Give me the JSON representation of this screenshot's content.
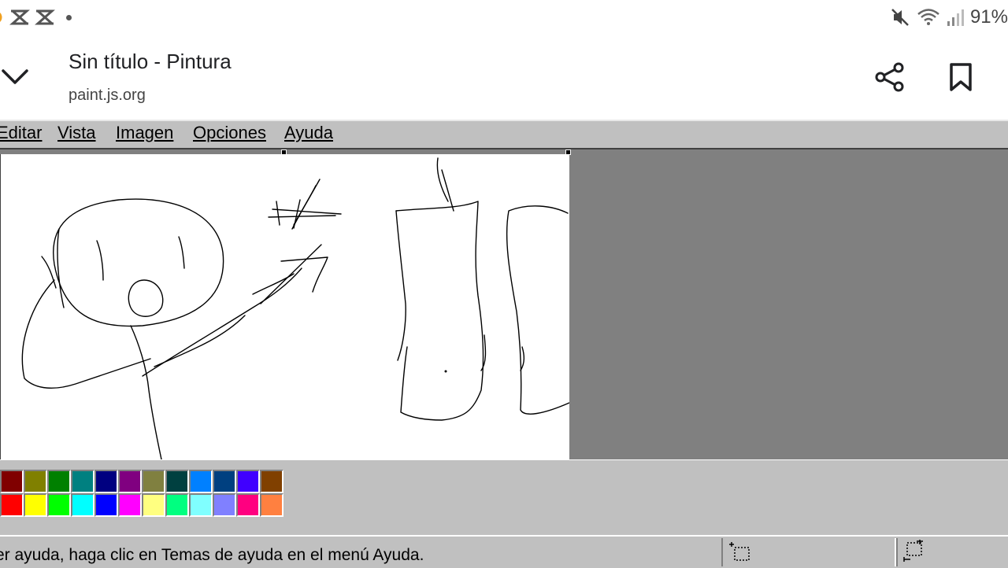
{
  "status_bar": {
    "left_icons": [
      "app-notification-icon",
      "capcut-icon",
      "capcut-icon-2",
      "more-dot"
    ],
    "right_icons": [
      "mute-icon",
      "wifi-icon",
      "signal-icon"
    ],
    "battery": "91%"
  },
  "browser": {
    "title": "Sin título - Pintura",
    "url": "paint.js.org"
  },
  "menu": {
    "items": [
      "Editar",
      "Vista",
      "Imagen",
      "Opciones",
      "Ayuda"
    ]
  },
  "palette": {
    "top_row": [
      "#800000",
      "#808000",
      "#008000",
      "#008080",
      "#000080",
      "#800080",
      "#808040",
      "#004040",
      "#0080ff",
      "#004080",
      "#4000ff",
      "#804000"
    ],
    "bottom_row": [
      "#ff0000",
      "#ffff00",
      "#00ff00",
      "#00ffff",
      "#0000ff",
      "#ff00ff",
      "#ffff80",
      "#00ff80",
      "#80ffff",
      "#8080ff",
      "#ff0080",
      "#ff8040"
    ]
  },
  "status": {
    "text": "er ayuda, haga clic en Temas de ayuda en el menú Ayuda."
  },
  "colors": {
    "app_bg": "#c0c0c0",
    "workspace_bg": "#808080",
    "canvas_bg": "#ffffff"
  }
}
